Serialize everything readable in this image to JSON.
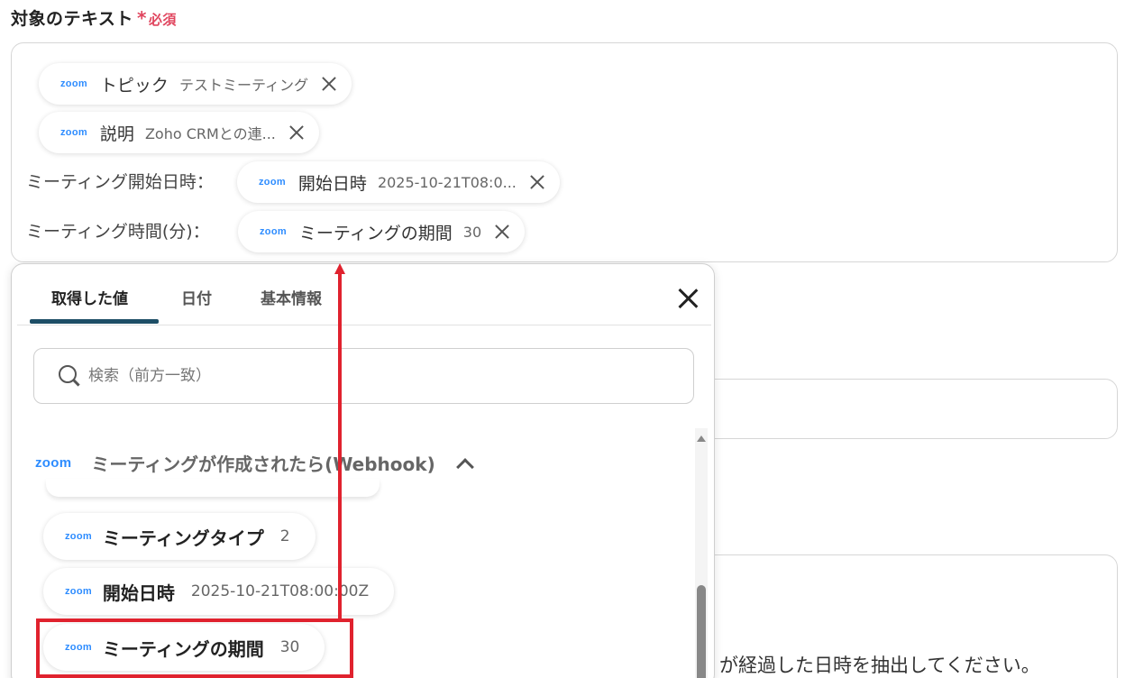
{
  "field": {
    "label": "対象のテキスト",
    "required_mark": "*",
    "required_text": "必須"
  },
  "text_area": {
    "chips": [
      {
        "logo": "zoom",
        "name": "トピック",
        "value": "テストミーティング"
      },
      {
        "logo": "zoom",
        "name": "説明",
        "value": "Zoho CRMとの連..."
      },
      {
        "logo": "zoom",
        "name": "開始日時",
        "value": "2025-10-21T08:0..."
      },
      {
        "logo": "zoom",
        "name": "ミーティングの期間",
        "value": "30"
      }
    ],
    "line_labels": [
      "ミーティング開始日時：",
      "ミーティング時間(分)："
    ]
  },
  "background_text": "が経過した日時を抽出してください。",
  "panel": {
    "tabs": [
      "取得した値",
      "日付",
      "基本情報"
    ],
    "active_tab": 0,
    "search_placeholder": "検索（前方一致）",
    "group": {
      "logo": "zoom",
      "title": "ミーティングが作成されたら(Webhook)"
    },
    "items": [
      {
        "logo": "zoom",
        "name": "ミーティングタイプ",
        "value": "2"
      },
      {
        "logo": "zoom",
        "name": "開始日時",
        "value": "2025-10-21T08:00:00Z"
      },
      {
        "logo": "zoom",
        "name": "ミーティングの期間",
        "value": "30"
      }
    ]
  },
  "icons": {
    "chip_remove": "close-icon",
    "panel_close": "close-icon",
    "search": "search-icon",
    "group_toggle": "chevron-up-icon"
  },
  "colors": {
    "required": "#e0455e",
    "zoom_brand": "#2d8cff",
    "tab_underline": "#1d4e66",
    "highlight": "#e0222e"
  }
}
